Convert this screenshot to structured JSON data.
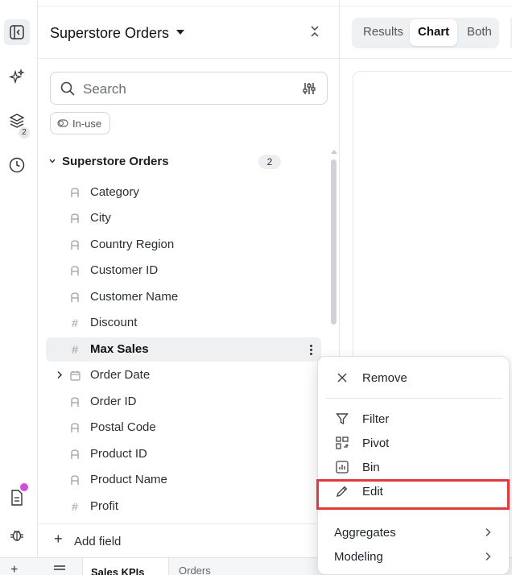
{
  "panel": {
    "title": "Superstore Orders",
    "search_placeholder": "Search",
    "chip_label": "In-use",
    "tree_title": "Superstore Orders",
    "tree_count": "2",
    "rail_badge": "2",
    "add_field_label": "Add field",
    "fields": [
      {
        "label": "Category",
        "type": "text"
      },
      {
        "label": "City",
        "type": "text"
      },
      {
        "label": "Country Region",
        "type": "text"
      },
      {
        "label": "Customer ID",
        "type": "text"
      },
      {
        "label": "Customer Name",
        "type": "text"
      },
      {
        "label": "Discount",
        "type": "number"
      },
      {
        "label": "Max Sales",
        "type": "number",
        "selected": true
      },
      {
        "label": "Order Date",
        "type": "date",
        "expandable": true
      },
      {
        "label": "Order ID",
        "type": "text"
      },
      {
        "label": "Postal Code",
        "type": "text"
      },
      {
        "label": "Product ID",
        "type": "text"
      },
      {
        "label": "Product Name",
        "type": "text"
      },
      {
        "label": "Profit",
        "type": "number"
      }
    ]
  },
  "view_toggle": {
    "results": "Results",
    "chart": "Chart",
    "both": "Both",
    "active": "Chart"
  },
  "bottom_tabs": {
    "tab1": "Sales KPIs",
    "tab2": "Orders"
  },
  "context_menu": {
    "remove": "Remove",
    "filter": "Filter",
    "pivot": "Pivot",
    "bin": "Bin",
    "edit": "Edit",
    "aggregates": "Aggregates",
    "modeling": "Modeling"
  },
  "colors": {
    "highlight_box": "#e0393e",
    "notification_dot": "#d34ed6",
    "selected_row_bg": "#eef0f2"
  }
}
